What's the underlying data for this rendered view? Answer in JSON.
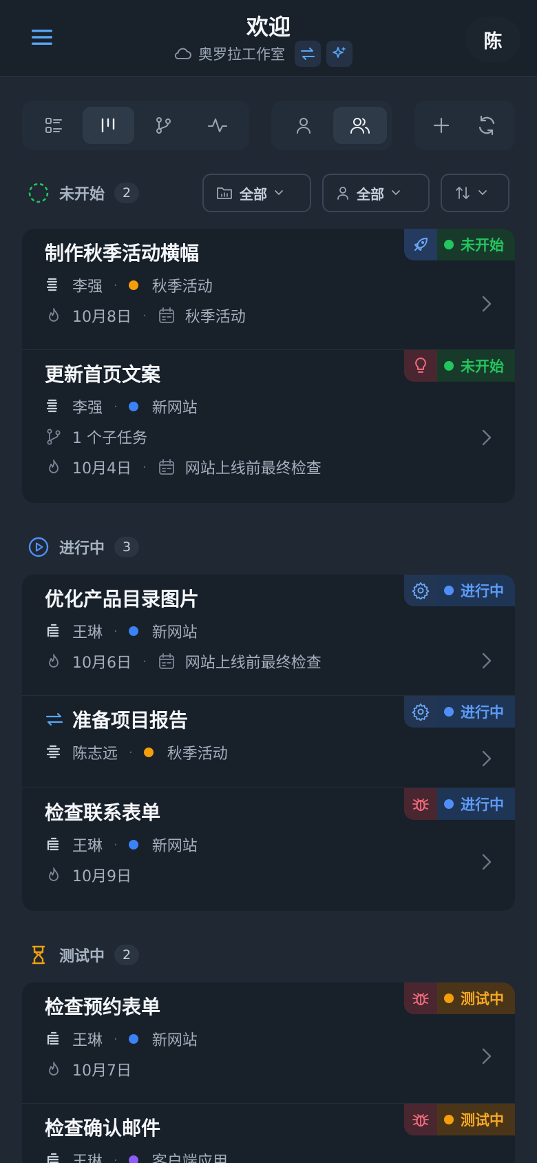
{
  "header": {
    "title": "欢迎",
    "workspace": "奥罗拉工作室",
    "avatar_initial": "陈"
  },
  "sections": {
    "todo": {
      "title": "未开始",
      "count": "2"
    },
    "doing": {
      "title": "进行中",
      "count": "3"
    },
    "testing": {
      "title": "测试中",
      "count": "2"
    }
  },
  "filters": {
    "project": "全部",
    "assignee": "全部"
  },
  "tasks": [
    {
      "title": "制作秋季活动横幅",
      "assignee": "李强",
      "project": "秋季活动",
      "due": "10月8日",
      "milestone": "秋季活动",
      "status": "未开始",
      "type_icon": "rocket-icon"
    },
    {
      "title": "更新首页文案",
      "assignee": "李强",
      "project": "新网站",
      "subtasks": "1 个子任务",
      "due": "10月4日",
      "milestone": "网站上线前最终检查",
      "status": "未开始",
      "type_icon": "lightbulb-icon"
    },
    {
      "title": "优化产品目录图片",
      "assignee": "王琳",
      "project": "新网站",
      "due": "10月6日",
      "milestone": "网站上线前最终检查",
      "status": "进行中",
      "type_icon": "gear-icon"
    },
    {
      "title": "准备项目报告",
      "assignee": "陈志远",
      "project": "秋季活动",
      "status": "进行中",
      "type_icon": "gear-icon",
      "recurring_icon": "repeat-icon"
    },
    {
      "title": "检查联系表单",
      "assignee": "王琳",
      "project": "新网站",
      "due": "10月9日",
      "status": "进行中",
      "type_icon": "bug-icon"
    },
    {
      "title": "检查预约表单",
      "assignee": "王琳",
      "project": "新网站",
      "due": "10月7日",
      "status": "测试中",
      "type_icon": "bug-icon"
    },
    {
      "title": "检查确认邮件",
      "assignee": "王琳",
      "project": "客户端应用",
      "status": "测试中",
      "type_icon": "bug-icon"
    }
  ],
  "colors": {
    "accent": "#4a8df5",
    "todo": "#22c55e",
    "doing": "#4f8ff7",
    "testing": "#f59e0b",
    "project_autumn": "#f59e0b",
    "project_website": "#3b82f6",
    "project_client": "#8b5cf6"
  }
}
